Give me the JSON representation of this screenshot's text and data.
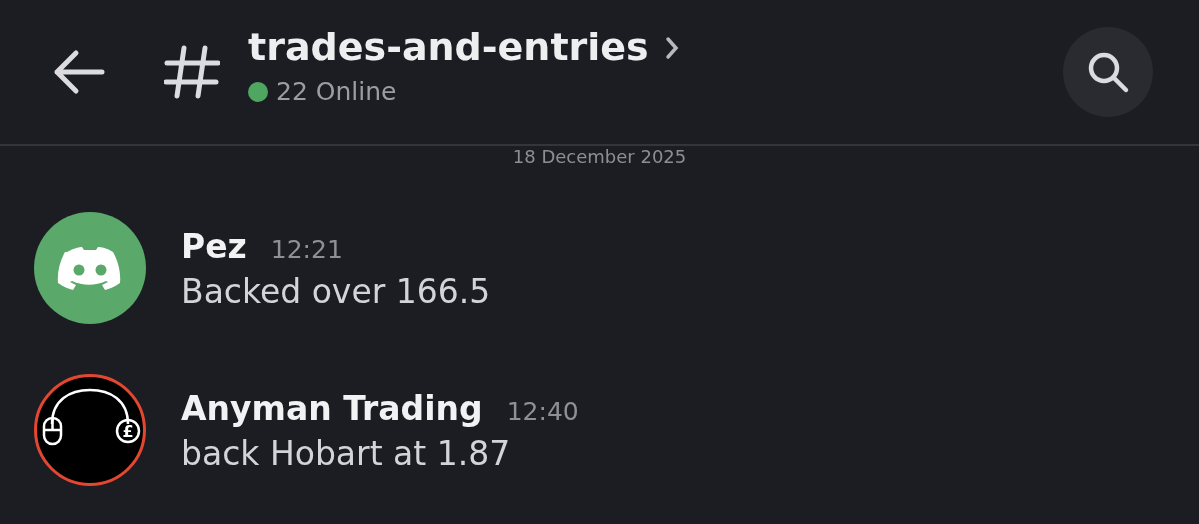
{
  "header": {
    "channel_name": "trades-and-entries",
    "online": "22 Online"
  },
  "date_divider": "18 December 2025",
  "messages": [
    {
      "author": "Pez",
      "time": "12:21",
      "text": "Backed over 166.5",
      "avatar": {
        "kind": "default",
        "color": "#5aa86a"
      }
    },
    {
      "author": "Anyman Trading",
      "time": "12:40",
      "text": "back Hobart at 1.87",
      "avatar": {
        "kind": "logo",
        "symbol": "£"
      }
    }
  ]
}
